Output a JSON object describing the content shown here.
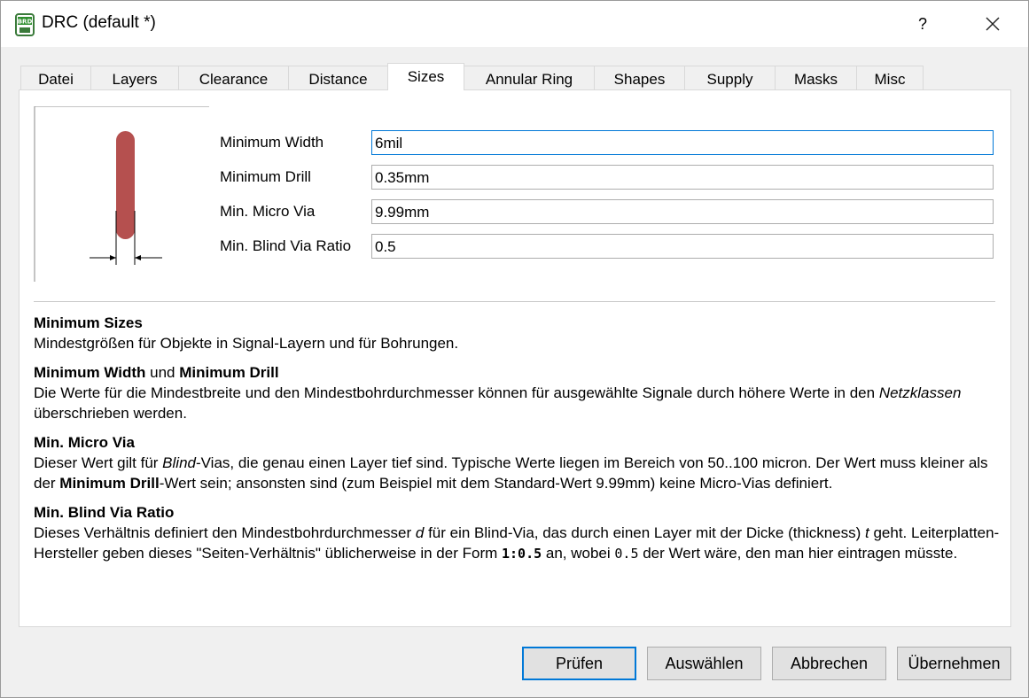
{
  "window": {
    "title": "DRC (default *)",
    "help_label": "?",
    "app_icon_text": "BRD"
  },
  "tabs": [
    {
      "label": "Datei"
    },
    {
      "label": "Layers"
    },
    {
      "label": "Clearance"
    },
    {
      "label": "Distance"
    },
    {
      "label": "Sizes",
      "active": true
    },
    {
      "label": "Annular Ring"
    },
    {
      "label": "Shapes"
    },
    {
      "label": "Supply"
    },
    {
      "label": "Masks"
    },
    {
      "label": "Misc"
    }
  ],
  "fields": {
    "minimum_width": {
      "label": "Minimum Width",
      "value": "6mil"
    },
    "minimum_drill": {
      "label": "Minimum Drill",
      "value": "0.35mm"
    },
    "min_micro_via": {
      "label": "Min. Micro Via",
      "value": "9.99mm"
    },
    "min_blind_via_ratio": {
      "label": "Min. Blind Via Ratio",
      "value": "0.5"
    }
  },
  "help": {
    "s1_title": "Minimum Sizes",
    "s1_text": "Mindestgrößen für Objekte in Signal-Layern und für Bohrungen.",
    "s2_title_a": "Minimum Width",
    "s2_title_mid": " und ",
    "s2_title_b": "Minimum Drill",
    "s2_text_a": "Die Werte für die Mindestbreite und den Mindestbohrdurchmesser können für ausgewählte Signale durch höhere Werte in den ",
    "s2_text_italic": "Netzklassen",
    "s2_text_b": " überschrieben werden.",
    "s3_title": "Min. Micro Via",
    "s3_text_a": "Dieser Wert gilt für ",
    "s3_text_italic": "Blind",
    "s3_text_b": "-Vias, die genau einen Layer tief sind. Typische Werte liegen im Bereich von 50..100 micron. Der Wert muss kleiner als der ",
    "s3_text_bold": "Minimum Drill",
    "s3_text_c": "-Wert sein; ansonsten sind (zum Beispiel mit dem Standard-Wert 9.99mm) keine Micro-Vias definiert.",
    "s4_title": "Min. Blind Via Ratio",
    "s4_text_a": "Dieses Verhältnis definiert den Mindestbohrdurchmesser ",
    "s4_text_d": "d",
    "s4_text_b": " für ein Blind-Via, das durch einen Layer mit der Dicke (thickness) ",
    "s4_text_t": "t",
    "s4_text_c": " geht. Leiterplatten-Hersteller geben dieses \"Seiten-Verhältnis\" üblicherweise in der Form ",
    "s4_mono_bold": "1:0.5",
    "s4_text_d2": " an, wobei ",
    "s4_mono": "0.5",
    "s4_text_e": " der Wert wäre, den man hier eintragen müsste."
  },
  "buttons": {
    "check": "Prüfen",
    "select": "Auswählen",
    "cancel": "Abbrechen",
    "apply": "Übernehmen"
  },
  "colors": {
    "accent": "#0078d7",
    "trace": "#b5504f"
  }
}
